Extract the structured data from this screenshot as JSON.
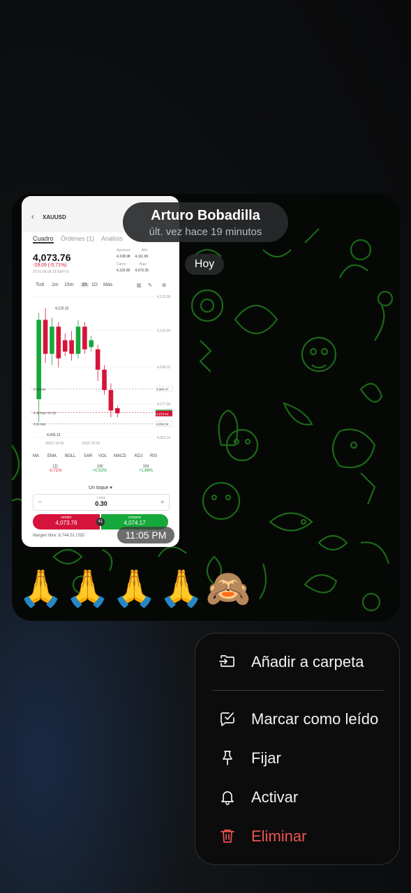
{
  "chat": {
    "contact_name": "Arturo Bobadilla",
    "last_seen": "últ. vez hace 19 minutos",
    "date_chip": "Hoy",
    "message_time": "11:05 PM",
    "emoji_reply": [
      "🙏",
      "🙏",
      "🙏",
      "🙏",
      "🙈"
    ]
  },
  "screenshot": {
    "symbol": "XAUUSD",
    "tabs": [
      "Cuadro",
      "Órdenes (1)",
      "Análisis"
    ],
    "price": "4,073.76",
    "change": "-29.09 (-0.71%)",
    "datetime": "07/31 08:05:18 GMT+3",
    "stats": [
      {
        "label": "Apertura",
        "value": "4,108.08"
      },
      {
        "label": "Alto",
        "value": "4,111.69"
      },
      {
        "label": "Cierre",
        "value": "4,102.85"
      },
      {
        "label": "Bajo",
        "value": "4,073.35"
      }
    ],
    "timeframes": [
      "Tick",
      "1m",
      "15m",
      "1h",
      "1D",
      "Más"
    ],
    "chart_high_label": "4,120.15",
    "chart_low_label": "4,065.12",
    "y_ticks": [
      "4,125.30",
      "4,110.40",
      "4,094.20",
      "4,077.90",
      "4,063.10"
    ],
    "x_ticks": [
      "30/07 18:00",
      "31/07 02:00"
    ],
    "order_labels": [
      "0.30 lote",
      "0.30 lote +67.50",
      "0.30 lote"
    ],
    "right_prices": [
      "4,084.47",
      "4,074.08",
      "4,073.64",
      "4,069.04"
    ],
    "indicators": [
      "MA",
      "EMA",
      "BOLL",
      "SAR",
      "VOL",
      "MACD",
      "KDJ",
      "RSI"
    ],
    "performance": [
      {
        "period": "1D",
        "value": "-0.71%"
      },
      {
        "period": "1W",
        "value": "+0.52%"
      },
      {
        "period": "1M",
        "value": "+1.66%"
      }
    ],
    "order_mode": "Un toque",
    "lots_label": "Lotes",
    "lots_value": "0.30",
    "sell_label": "vender",
    "sell_price": "4,073.76",
    "spread": "41",
    "buy_label": "comprar",
    "buy_price": "4,074.17",
    "margin_free": "Margen libre: 6,744.51 USD"
  },
  "chart_data": {
    "type": "bar",
    "title": "",
    "xlabel": "",
    "ylabel": "",
    "ylim": [
      4063.1,
      4125.3
    ],
    "candles": [
      {
        "open": 4080,
        "close": 4115,
        "high": 4118,
        "low": 4070
      },
      {
        "open": 4115,
        "close": 4100,
        "high": 4120.15,
        "low": 4096
      },
      {
        "open": 4100,
        "close": 4112,
        "high": 4116,
        "low": 4095
      },
      {
        "open": 4112,
        "close": 4098,
        "high": 4114,
        "low": 4094
      },
      {
        "open": 4106,
        "close": 4101,
        "high": 4109,
        "low": 4099
      },
      {
        "open": 4106,
        "close": 4100,
        "high": 4110,
        "low": 4097
      },
      {
        "open": 4100,
        "close": 4112,
        "high": 4115,
        "low": 4098
      },
      {
        "open": 4112,
        "close": 4102,
        "high": 4114,
        "low": 4100
      },
      {
        "open": 4103,
        "close": 4106,
        "high": 4108,
        "low": 4101
      },
      {
        "open": 4102,
        "close": 4093,
        "high": 4104,
        "low": 4088
      },
      {
        "open": 4093,
        "close": 4084,
        "high": 4095,
        "low": 4082
      },
      {
        "open": 4084,
        "close": 4075,
        "high": 4087,
        "low": 4072
      },
      {
        "open": 4076,
        "close": 4073.76,
        "high": 4077,
        "low": 4072
      }
    ]
  },
  "menu": {
    "items": [
      {
        "label": "Añadir a carpeta",
        "icon": "folder-add-icon",
        "danger": false
      },
      {
        "label": "Marcar como leído",
        "icon": "mark-read-icon",
        "danger": false
      },
      {
        "label": "Fijar",
        "icon": "pin-icon",
        "danger": false
      },
      {
        "label": "Activar",
        "icon": "bell-icon",
        "danger": false
      },
      {
        "label": "Eliminar",
        "icon": "trash-icon",
        "danger": true
      }
    ],
    "danger_color": "#ef5350"
  }
}
